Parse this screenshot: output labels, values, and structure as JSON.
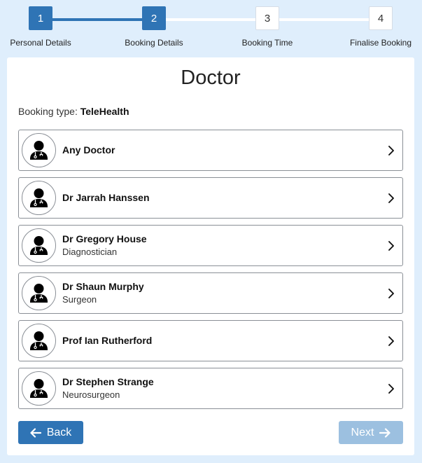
{
  "stepper": {
    "steps": [
      {
        "number": "1",
        "label": "Personal Details"
      },
      {
        "number": "2",
        "label": "Booking Details"
      },
      {
        "number": "3",
        "label": "Booking Time"
      },
      {
        "number": "4",
        "label": "Finalise Booking"
      }
    ],
    "current_step": 2
  },
  "main": {
    "title": "Doctor",
    "booking_type_label": "Booking type:",
    "booking_type_value": "TeleHealth",
    "doctors": [
      {
        "name": "Any Doctor",
        "specialty": ""
      },
      {
        "name": "Dr Jarrah Hanssen",
        "specialty": ""
      },
      {
        "name": "Dr Gregory House",
        "specialty": "Diagnostician"
      },
      {
        "name": "Dr Shaun Murphy",
        "specialty": "Surgeon"
      },
      {
        "name": "Prof Ian Rutherford",
        "specialty": ""
      },
      {
        "name": "Dr Stephen Strange",
        "specialty": "Neurosurgeon"
      }
    ]
  },
  "footer": {
    "back_label": "Back",
    "next_label": "Next",
    "next_disabled": true
  },
  "icons": {
    "avatar": "doctor-avatar-icon",
    "row_arrow": "chevron-right-icon",
    "back": "arrow-left-icon",
    "next": "arrow-right-icon"
  },
  "colors": {
    "accent": "#2f74b5",
    "disabled_button": "#9cc0e0",
    "background": "#dfeefc"
  }
}
